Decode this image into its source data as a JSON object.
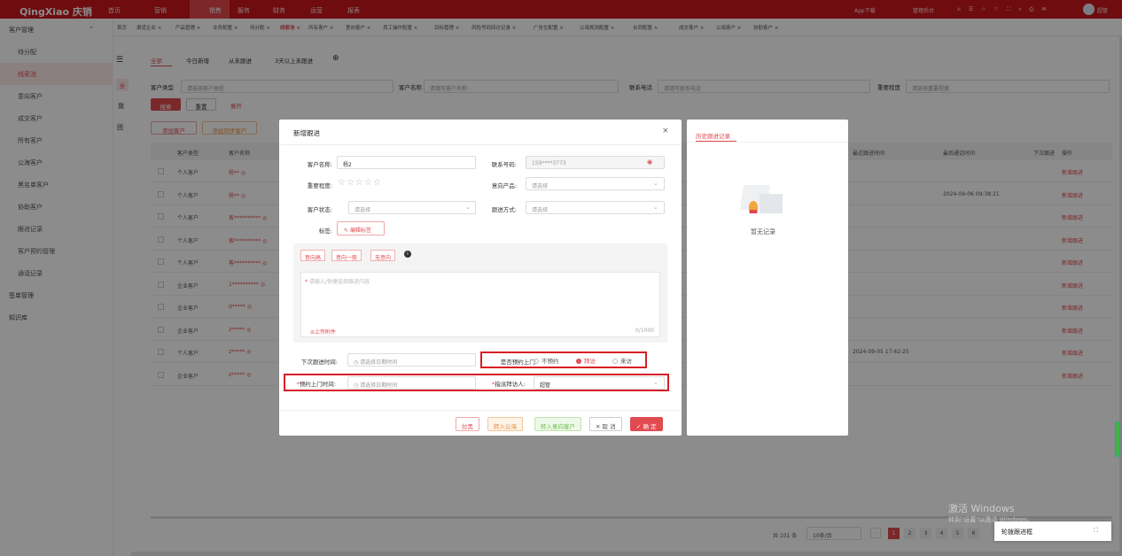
{
  "app": {
    "logo": "QingXiao 庆销",
    "nav": [
      "首页",
      "营销",
      "销售",
      "服务",
      "财务",
      "运营",
      "报表"
    ],
    "active_nav": "销售",
    "topright": [
      "App下载",
      "管理后台"
    ],
    "user": "超管"
  },
  "tabs": [
    "首页",
    "渠道企业",
    "产品管理",
    "业务配置",
    "待分配",
    "线索池",
    "所有客户",
    "意向客户",
    "员工操作配置",
    "目标管理",
    "风险号码回访记录",
    "广告位配置",
    "公海规则配置",
    "合同配置",
    "成交客户",
    "公海客户",
    "协助客户"
  ],
  "active_tab": "线索池",
  "sidebar": {
    "head": "客户管理",
    "items": [
      "待分配",
      "线索池",
      "意向客户",
      "成交客户",
      "所有客户",
      "公海客户",
      "黑名单客户",
      "协助客户",
      "跟进记录",
      "客户预约管理",
      "通话记录"
    ],
    "active": "线索池",
    "sections": [
      "签单管理",
      "知识库"
    ]
  },
  "filter": {
    "tabs": [
      "全部",
      "今日新增",
      "从未跟进",
      "3天以上未跟进"
    ],
    "active_tab": "全部",
    "customer_type_label": "客户类型",
    "customer_type_ph": "请选择客户类型",
    "customer_name_label": "客户名称",
    "customer_name_ph": "请填写客户名称",
    "phone_label": "联系电话",
    "phone_ph": "请填写联系电话",
    "importance_label": "重要程度",
    "importance_ph": "请选择重要程度",
    "search": "搜索",
    "reset": "重置",
    "expand": "展开",
    "add_customer": "添加客户",
    "add_sync": "添加同步客户"
  },
  "table": {
    "headers": [
      "客户类型",
      "客户名称"
    ],
    "right_headers": [
      "最近跟进时间",
      "最后通话时间",
      "下次跟进",
      "操作"
    ],
    "rows": [
      {
        "type": "个人客户",
        "name": "杨**",
        "time1": "",
        "time2": "",
        "op": "新增跟进"
      },
      {
        "type": "个人客户",
        "name": "杨**",
        "time1": "",
        "time2": "2024-09-06 09:38:21",
        "op": "新增跟进"
      },
      {
        "type": "个人客户",
        "name": "客**********",
        "time1": "",
        "time2": "",
        "op": "新增跟进"
      },
      {
        "type": "个人客户",
        "name": "客**********",
        "time1": "",
        "time2": "",
        "op": "新增跟进"
      },
      {
        "type": "个人客户",
        "name": "客**********",
        "time1": "",
        "time2": "",
        "op": "新增跟进"
      },
      {
        "type": "企业客户",
        "name": "1**********",
        "time1": "",
        "time2": "",
        "op": "新增跟进"
      },
      {
        "type": "企业客户",
        "name": "d*****",
        "time1": "",
        "time2": "",
        "op": "新增跟进"
      },
      {
        "type": "企业客户",
        "name": "z*****",
        "time1": "",
        "time2": "",
        "op": "新增跟进"
      },
      {
        "type": "个人客户",
        "name": "z*****",
        "time1": "2024-09-05 17:42:25",
        "time2": "",
        "op": "新增跟进"
      },
      {
        "type": "企业客户",
        "name": "z*****",
        "time1": "",
        "time2": "",
        "op": "新增跟进"
      }
    ]
  },
  "pagination": {
    "total": "共 101 条",
    "per_page": "10条/页",
    "pages": [
      "1",
      "2",
      "3",
      "4",
      "5",
      "6"
    ],
    "active": "1"
  },
  "dialog": {
    "title": "新增跟进",
    "name_label": "客户名称:",
    "name_value": "杨2",
    "phone_label": "联系号码:",
    "phone_value": "159****3773",
    "importance_label": "重要程度:",
    "stars": "☆☆☆☆☆",
    "product_label": "意向产品:",
    "product_ph": "请选择",
    "status_label": "客户状态:",
    "status_ph": "请选择",
    "method_label": "跟进方式:",
    "method_ph": "请选择",
    "tags_label": "标签:",
    "tags_btn": "编辑标签",
    "quick_tags": [
      "意向高",
      "意向一般",
      "无意向"
    ],
    "content_ph": "请输入/快捷选择跟进内容",
    "attach": "上传附件",
    "counter": "0/1000",
    "next_label": "下次跟进时间:",
    "next_ph": "请选择日期时间",
    "visit_label": "是否预约上门:",
    "visit_options": [
      "不预约",
      "拜访",
      "来访"
    ],
    "visit_selected": "拜访",
    "appt_label": "预约上门时间:",
    "appt_ph": "请选择日期时间",
    "visitor_label": "指派拜访人:",
    "visitor_value": "超管",
    "buttons": {
      "blacklist": "拉黑",
      "to_sea": "转入公海",
      "to_intent": "转入意向客户",
      "cancel": "取 消",
      "ok": "确 定"
    }
  },
  "history": {
    "tab": "历史跟进记录",
    "empty": "暂无记录"
  },
  "watermark": {
    "line1": "激活 Windows",
    "line2": "转到\"设置\"以激活 Windows。"
  },
  "float_btn": "轮拨跟进框"
}
